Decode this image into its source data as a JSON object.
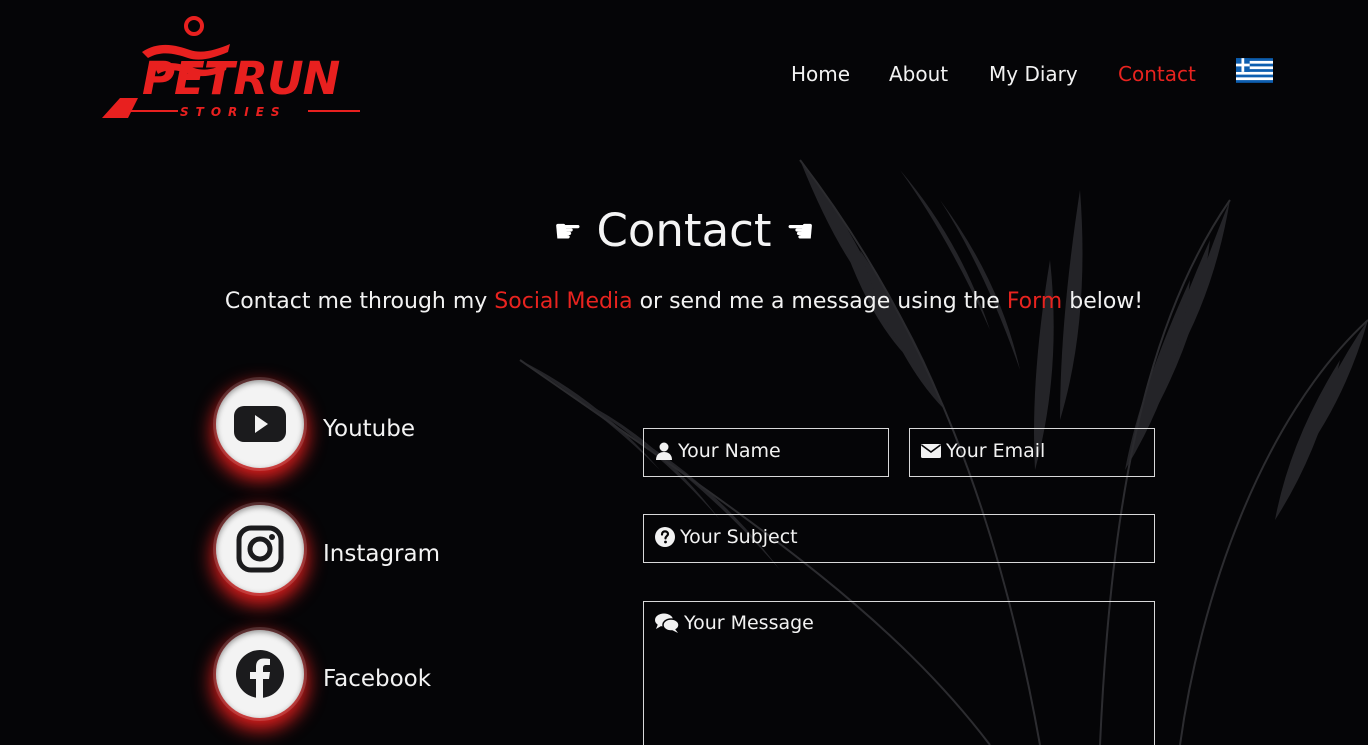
{
  "brand": {
    "logo_text": "PETRUN",
    "logo_subtext": "STORIES",
    "accent_color": "#e8231f"
  },
  "nav": {
    "items": [
      {
        "label": "Home",
        "active": false
      },
      {
        "label": "About",
        "active": false
      },
      {
        "label": "My Diary",
        "active": false
      },
      {
        "label": "Contact",
        "active": true
      }
    ],
    "language_flag": "greece-flag-icon"
  },
  "hero": {
    "title": "Contact",
    "hand_left": "☛",
    "hand_right": "☚",
    "subtitle_parts": {
      "p1": "Contact me through my ",
      "a1": "Social Media",
      "p2": " or send me a message using the ",
      "a2": "Form",
      "p3": " below!"
    }
  },
  "social": [
    {
      "label": "Youtube",
      "icon": "youtube-icon"
    },
    {
      "label": "Instagram",
      "icon": "instagram-icon"
    },
    {
      "label": "Facebook",
      "icon": "facebook-icon"
    }
  ],
  "form": {
    "name_placeholder": "Your Name",
    "email_placeholder": "Your Email",
    "subject_placeholder": "Your Subject",
    "message_placeholder": "Your Message"
  }
}
